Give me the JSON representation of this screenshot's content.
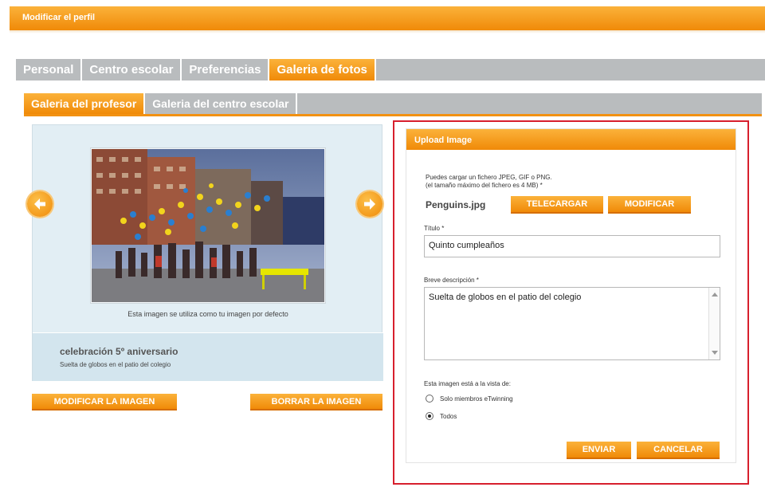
{
  "header": {
    "title": "Modificar el perfil"
  },
  "tabs": [
    "Personal",
    "Centro escolar",
    "Preferencias",
    "Galeria de fotos"
  ],
  "active_tab": "Galeria de fotos",
  "subtabs": [
    "Galeria del profesor",
    "Galeria del centro escolar"
  ],
  "active_subtab": "Galeria del profesor",
  "gallery": {
    "caption": "Esta imagen se utiliza como tu imagen por defecto",
    "title": "celebración 5º aniversario",
    "description": "Suelta de globos en el patio del colegio",
    "modify_button": "MODIFICAR LA IMAGEN",
    "delete_button": "BORRAR LA IMAGEN"
  },
  "upload": {
    "heading": "Upload Image",
    "help_line1": "Puedes cargar un fichero JPEG, GIF o PNG.",
    "help_line2": "(el tamaño máximo del fichero es 4 MB) *",
    "filename": "Penguins.jpg",
    "upload_button": "TELECARGAR",
    "change_button": "MODIFICAR",
    "title_label": "Título *",
    "title_value": "Quinto cumpleaños",
    "desc_label": "Breve descripción *",
    "desc_value": "Suelta de globos en el patio del colegio",
    "visibility_label": "Esta imagen está a la vista de:",
    "options": [
      {
        "label": "Solo miembros eTwinning",
        "selected": false
      },
      {
        "label": "Todos",
        "selected": true
      }
    ],
    "send_button": "ENVIAR",
    "cancel_button": "CANCELAR"
  },
  "colors": {
    "accent_orange": "#f29112",
    "tab_gray": "#b9bcbe",
    "highlight_red": "#d71f2d",
    "panel_blue": "#e2eef4"
  },
  "icons": {
    "prev": "arrow-left-circle-icon",
    "next": "arrow-right-circle-icon"
  }
}
